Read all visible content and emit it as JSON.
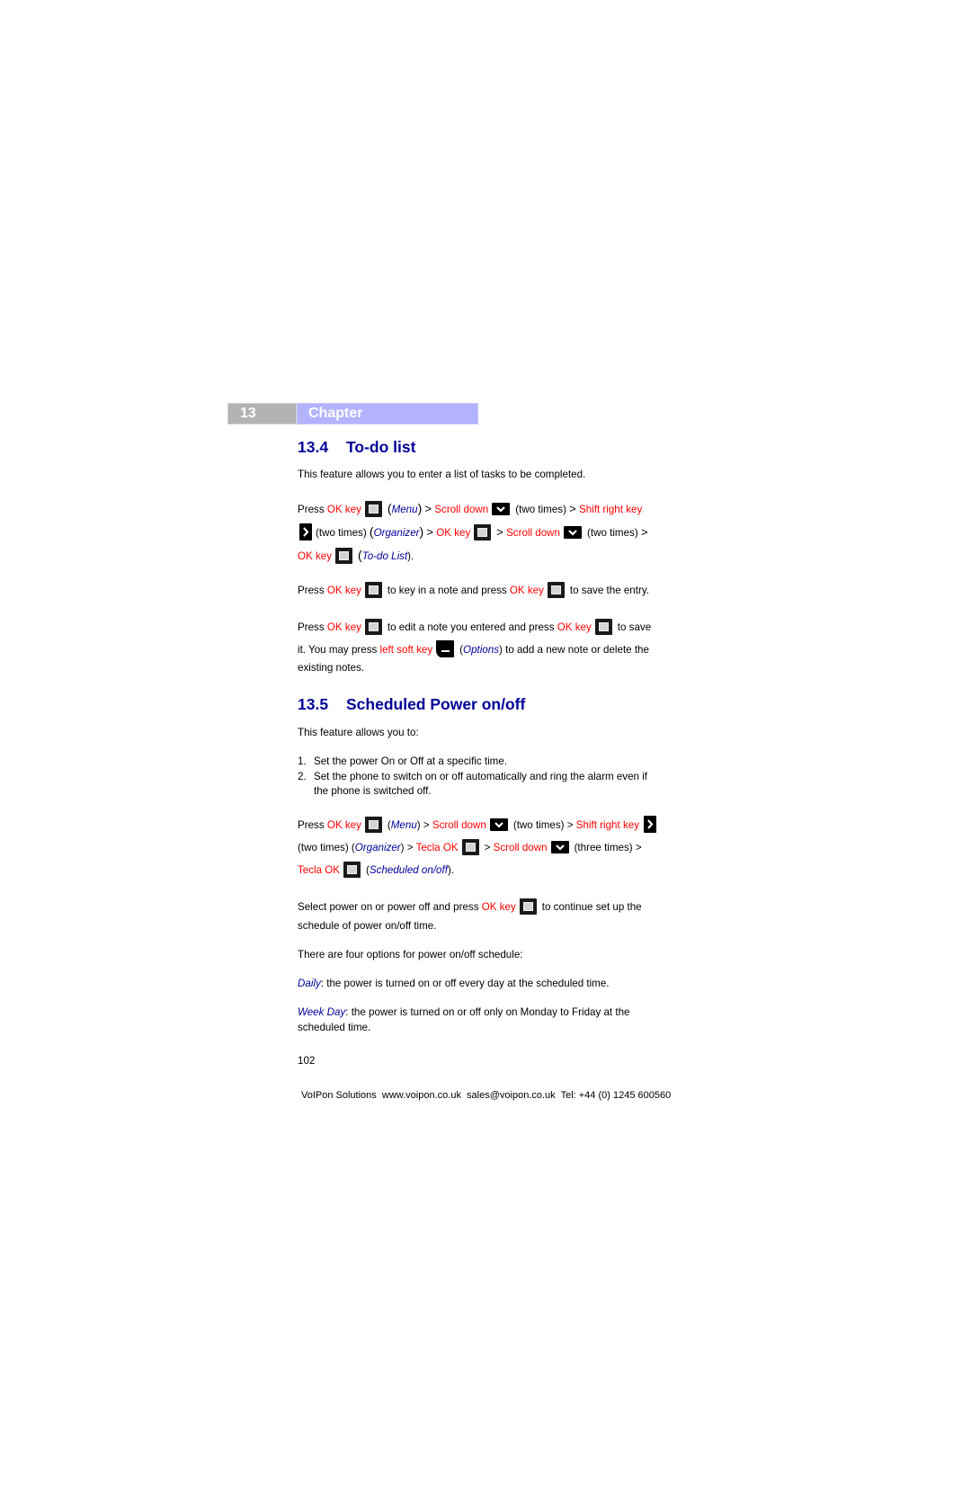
{
  "header": {
    "chapter_number": "13",
    "chapter_label": "Chapter"
  },
  "section_13_4": {
    "number": "13.4",
    "title": "To-do list",
    "intro": "This feature allows you to enter a list of tasks to be completed.",
    "nav": {
      "press": "Press",
      "ok_key": "OK key",
      "menu": "Menu",
      "gt": ">",
      "scroll_down": "Scroll down",
      "two_times": "(two times)",
      "shift_right_key": "Shift right key",
      "organizer": "Organizer",
      "todo_list": "To-do List",
      "open_paren": "(",
      "close_paren": ")",
      "close_paren_dot": ")."
    },
    "p2": {
      "press": "Press",
      "ok_key": "OK key",
      "mid": "to key in a note and press",
      "ok_key2": "OK key",
      "end": "to save the entry."
    },
    "p3": {
      "press": "Press",
      "ok_key": "OK key",
      "mid": "to edit a note you entered and press",
      "ok_key2": "OK key",
      "end": "to save",
      "line2_start": "it. You may press",
      "left_soft_key": "left soft key",
      "options": "Options",
      "line2_end": ") to add a new note or delete the",
      "line3": "existing notes."
    }
  },
  "section_13_5": {
    "number": "13.5",
    "title": "Scheduled Power on/off",
    "intro": "This feature allows you to:",
    "list": [
      {
        "n": "1.",
        "text": "Set the power On or Off at a specific time."
      },
      {
        "n": "2.",
        "text": "Set the phone to switch on or off automatically and ring the alarm even if",
        "text2": "the phone is switched off."
      }
    ],
    "nav": {
      "press": "Press",
      "ok_key": "OK key",
      "menu": "Menu",
      "scroll_down": "Scroll down",
      "two_times": "(two times) >",
      "shift_right_key": "Shift right key",
      "two_times_2": "(two times) (",
      "organizer": "Organizer",
      "tecla_ok": "Tecla OK",
      "three_times": "(three times) >",
      "scheduled": "Scheduled on/off",
      "gt": ">"
    },
    "select": {
      "start": "Select power on or power off and press",
      "ok_key": "OK key",
      "end": "to continue set up the",
      "line2": "schedule of power on/off time."
    },
    "options_intro": "There are four options for power on/off schedule:",
    "daily": {
      "term": "Daily",
      "desc": ": the power is turned on or off every day at the scheduled time."
    },
    "weekday": {
      "term": "Week Day",
      "desc": ": the power is turned on or off only on Monday to Friday at the",
      "desc2": "scheduled time."
    }
  },
  "page_number": "102",
  "footer": "VoIPon Solutions  www.voipon.co.uk  sales@voipon.co.uk  Tel: +44 (0) 1245 600560"
}
